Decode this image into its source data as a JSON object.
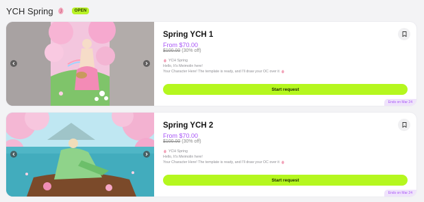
{
  "header": {
    "title": "YCH Spring",
    "status_badge": "OPEN"
  },
  "colors": {
    "accent": "#b5f71f",
    "price": "#a855f7",
    "badge": "#b9f227"
  },
  "cards": [
    {
      "title": "Spring YCH 1",
      "price": "From $70.00",
      "original_price": "$100.00",
      "discount": "(30% off)",
      "collection": "YCH Spring",
      "description_1": "Hello, It's Meimolin here!",
      "description_2": "Your Character Here! The template is ready, and I'll draw your OC over it",
      "button": "Start request",
      "ends": "Ends on Mar 24"
    },
    {
      "title": "Spring YCH 2",
      "price": "From $70.00",
      "original_price": "$100.00",
      "discount": "(30% off)",
      "collection": "YCH Spring",
      "description_1": "Hello, It's Meimolin here!",
      "description_2": "Your Character Here! The template is ready, and I'll draw your OC over it",
      "button": "Start request",
      "ends": "Ends on Mar 24"
    }
  ]
}
